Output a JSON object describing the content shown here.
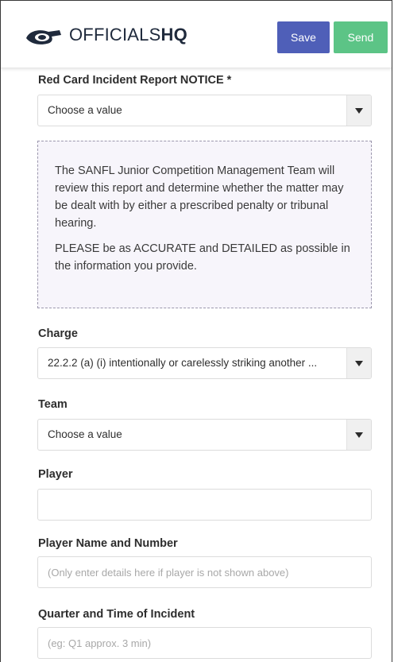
{
  "header": {
    "brand_regular": "OFFICIALS",
    "brand_bold": "HQ",
    "save_label": "Save",
    "send_label": "Send"
  },
  "form": {
    "red_card_notice": {
      "label": "Red Card Incident Report NOTICE *",
      "value": "Choose a value"
    },
    "notice_box": {
      "paragraph1": "The SANFL Junior Competition Management Team will review this report and determine whether the matter may be dealt with by either a prescribed penalty or tribunal hearing.",
      "paragraph2": "PLEASE be as ACCURATE and DETAILED as possible in the information you provide."
    },
    "charge": {
      "label": "Charge",
      "value": "22.2.2 (a) (i) intentionally or carelessly striking another ..."
    },
    "team": {
      "label": "Team",
      "value": "Choose a value"
    },
    "player": {
      "label": "Player",
      "value": ""
    },
    "player_name_number": {
      "label": "Player Name and Number",
      "placeholder": "(Only enter details here if player is not shown above)"
    },
    "quarter_time": {
      "label": "Quarter and Time of Incident",
      "placeholder": "(eg: Q1 approx. 3 min)"
    }
  },
  "colors": {
    "save_button": "#4f5fb8",
    "send_button": "#5cc486",
    "notice_background": "#f7f5fb"
  },
  "icons": {
    "logo": "whistle-icon",
    "select_arrow": "caret-down-icon"
  }
}
